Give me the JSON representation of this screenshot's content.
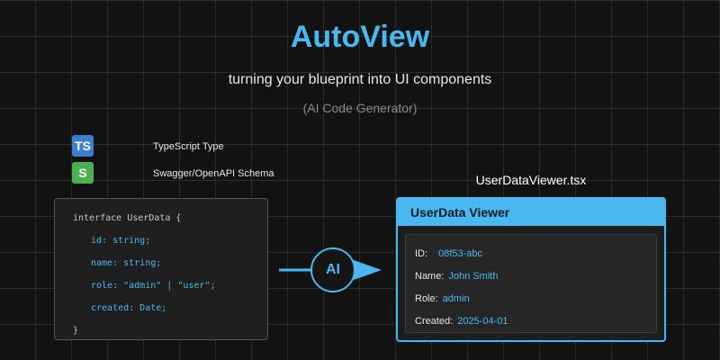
{
  "header": {
    "title": "AutoView",
    "subtitle": "turning your blueprint into UI components",
    "caption": "(AI Code Generator)"
  },
  "inputs": [
    {
      "badge": "TS",
      "label": "TypeScript Type",
      "color": "#3b7fd1"
    },
    {
      "badge": "S",
      "label": "Swagger/OpenAPI Schema",
      "color": "#4caf50"
    }
  ],
  "code": {
    "lines": [
      "interface UserData {",
      "id: string;",
      "name: string;",
      "role: \"admin\" | \"user\";",
      "created: Date;",
      "}"
    ]
  },
  "arrow": {
    "label": "AI"
  },
  "output": {
    "filename": "UserDataViewer.tsx",
    "title": "UserData Viewer",
    "fields": [
      {
        "key": "ID:",
        "value": "08f53-abc"
      },
      {
        "key": "Name:",
        "value": "John Smith"
      },
      {
        "key": "Role:",
        "value": "admin"
      },
      {
        "key": "Created:",
        "value": "2025-04-01"
      }
    ]
  },
  "colors": {
    "accent": "#4ab8f0",
    "background": "#121212",
    "grid": "#2b2b2b"
  }
}
